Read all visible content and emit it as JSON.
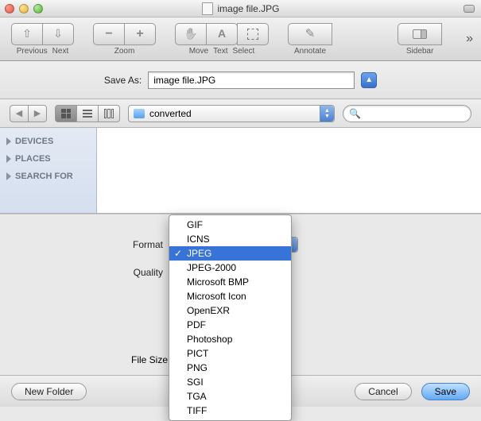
{
  "window": {
    "title": "image file.JPG"
  },
  "toolbar": {
    "previous": "Previous",
    "next": "Next",
    "zoom": "Zoom",
    "move": "Move",
    "text": "Text",
    "select": "Select",
    "annotate": "Annotate",
    "sidebar": "Sidebar"
  },
  "save_sheet": {
    "save_as_label": "Save As:",
    "filename": "image file.JPG",
    "location_label": "converted",
    "search_placeholder": "",
    "sidebar": {
      "devices": "DEVICES",
      "places": "PLACES",
      "search_for": "SEARCH FOR"
    },
    "format_label": "Format",
    "quality_label": "Quality",
    "filesize_label": "File Size",
    "new_folder": "New Folder",
    "cancel": "Cancel",
    "save": "Save"
  },
  "format_menu": {
    "selected": "JPEG",
    "items": [
      "GIF",
      "ICNS",
      "JPEG",
      "JPEG-2000",
      "Microsoft BMP",
      "Microsoft Icon",
      "OpenEXR",
      "PDF",
      "Photoshop",
      "PICT",
      "PNG",
      "SGI",
      "TGA",
      "TIFF"
    ]
  }
}
